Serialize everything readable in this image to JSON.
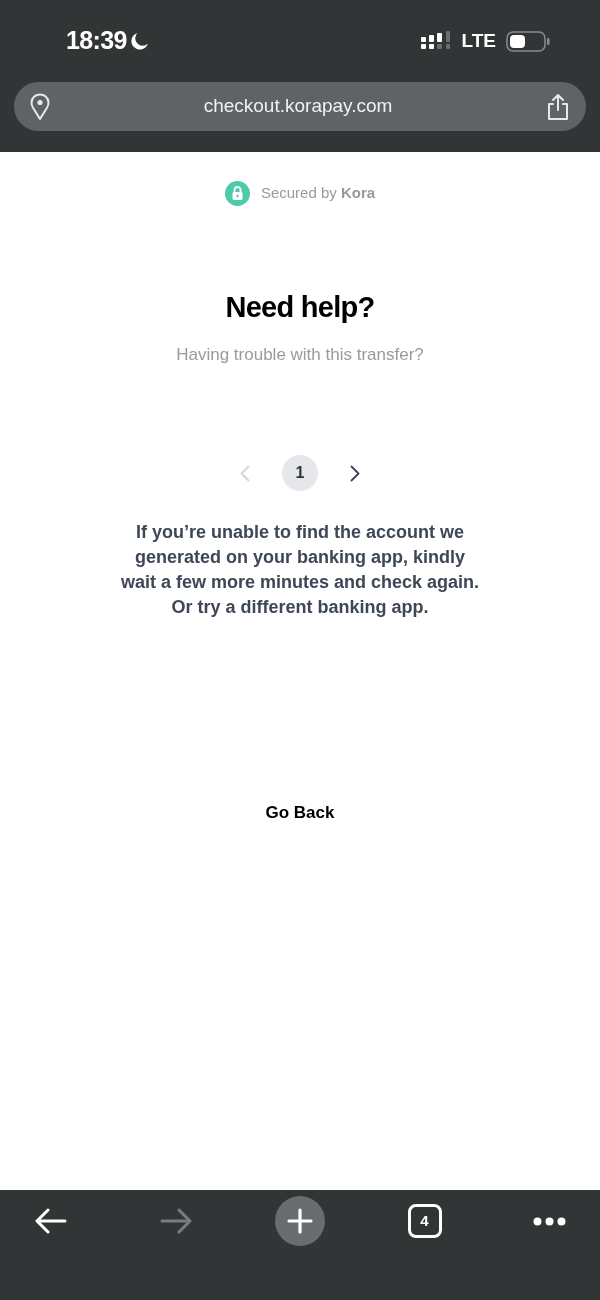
{
  "status_bar": {
    "time": "18:39",
    "network": "LTE"
  },
  "address_bar": {
    "url": "checkout.korapay.com"
  },
  "page": {
    "security_note": "Secured by **Kora**",
    "title": "Need help?",
    "subtitle": "Having trouble with this transfer?",
    "pagination": {
      "previous": {
        "disabled": true
      },
      "pages": [
        {
          "label": "1",
          "selected": true
        }
      ],
      "next": {
        "disabled": false
      }
    },
    "message": "If you’re unable to find the account we generated on your banking app, kindly wait a few more minutes and check again. Or try a different banking app.",
    "go_back": "Go Back"
  },
  "toolbar": {
    "back": {
      "disabled": false
    },
    "forward": {
      "disabled": true
    },
    "tab_count": "4"
  }
}
